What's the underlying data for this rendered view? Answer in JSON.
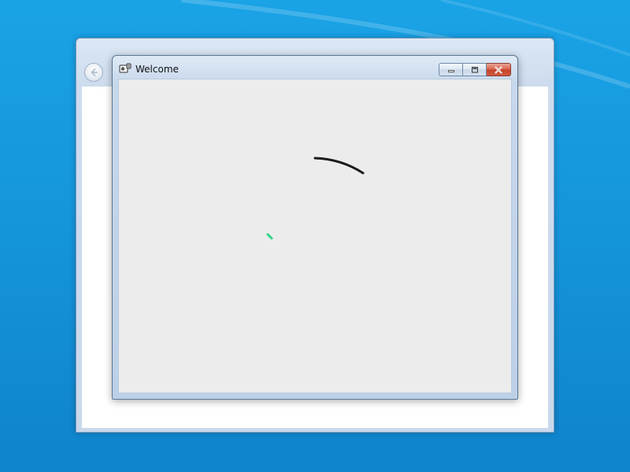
{
  "desktop": {
    "background_color": "#1596dc"
  },
  "outer_window": {
    "back_icon": "back-arrow-icon"
  },
  "inner_window": {
    "title": "Welcome",
    "app_icon": "app-icon",
    "caption_buttons": {
      "minimize_icon": "minimize-icon",
      "maximize_icon": "maximize-icon",
      "close_icon": "close-icon"
    },
    "client_background": "#ececec",
    "loading_arc_color": "#1a1a1a",
    "loading_dot_color": "#2fd38a"
  }
}
